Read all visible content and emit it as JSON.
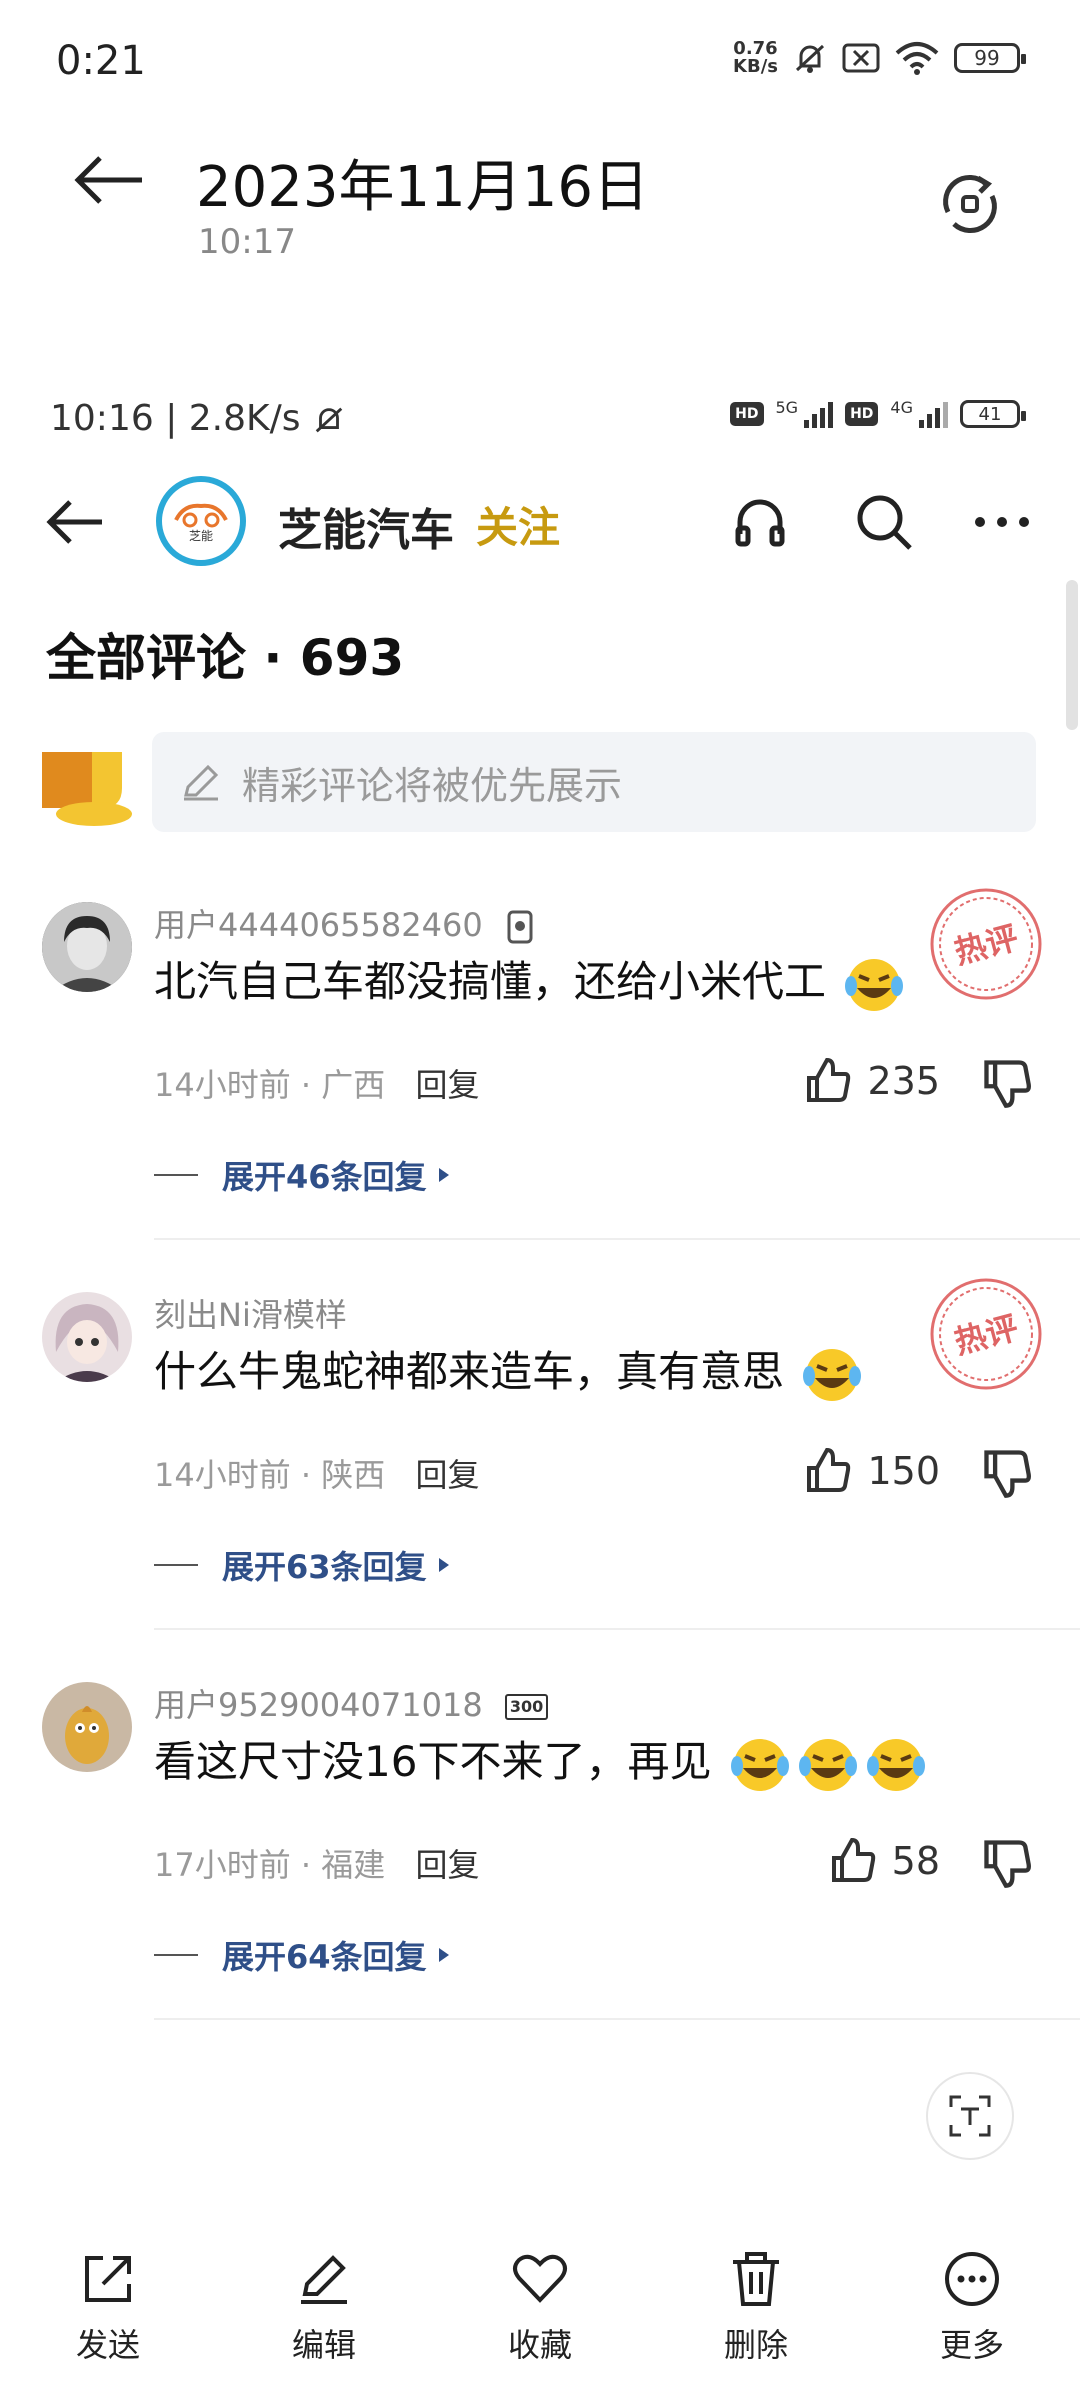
{
  "status_bar": {
    "time": "0:21",
    "speed_value": "0.76",
    "speed_unit": "KB/s",
    "battery": "99"
  },
  "gallery": {
    "title": "2023年11月16日",
    "subtitle": "10:17"
  },
  "inner_status": {
    "text": "10:16 | 2.8K/s",
    "net1": "5G",
    "net2": "4G",
    "hd": "HD",
    "battery": "41"
  },
  "app_header": {
    "account_name": "芝能汽车",
    "follow_label": "关注",
    "logo_text": "芝能"
  },
  "comments_header": {
    "title": "全部评论 · 693"
  },
  "comment_input": {
    "placeholder": "精彩评论将被优先展示"
  },
  "comments": [
    {
      "username": "用户4444065582460",
      "text": "北汽自己车都没搞懂，还给小米代工",
      "time": "14小时前",
      "location": "广西",
      "reply_label": "回复",
      "likes": "235",
      "expand_label": "展开46条回复",
      "hot_label": "热评"
    },
    {
      "username": "刻出Ni滑模样",
      "text": "什么牛鬼蛇神都来造车，真有意思",
      "time": "14小时前",
      "location": "陕西",
      "reply_label": "回复",
      "likes": "150",
      "expand_label": "展开63条回复",
      "hot_label": "热评"
    },
    {
      "username": "用户9529004071018",
      "badge": "300",
      "text": "看这尺寸没16下不来了，再见",
      "time": "17小时前",
      "location": "福建",
      "reply_label": "回复",
      "likes": "58",
      "expand_label": "展开64条回复"
    }
  ],
  "toolbar": [
    {
      "label": "发送",
      "icon": "share-icon"
    },
    {
      "label": "编辑",
      "icon": "edit-icon"
    },
    {
      "label": "收藏",
      "icon": "heart-icon"
    },
    {
      "label": "删除",
      "icon": "trash-icon"
    },
    {
      "label": "更多",
      "icon": "more-icon"
    }
  ],
  "colors": {
    "follow": "#c79a10",
    "expand_link": "#2f4f88",
    "hot_stamp": "#d94a4a",
    "logo_ring": "#2aa9d8"
  }
}
